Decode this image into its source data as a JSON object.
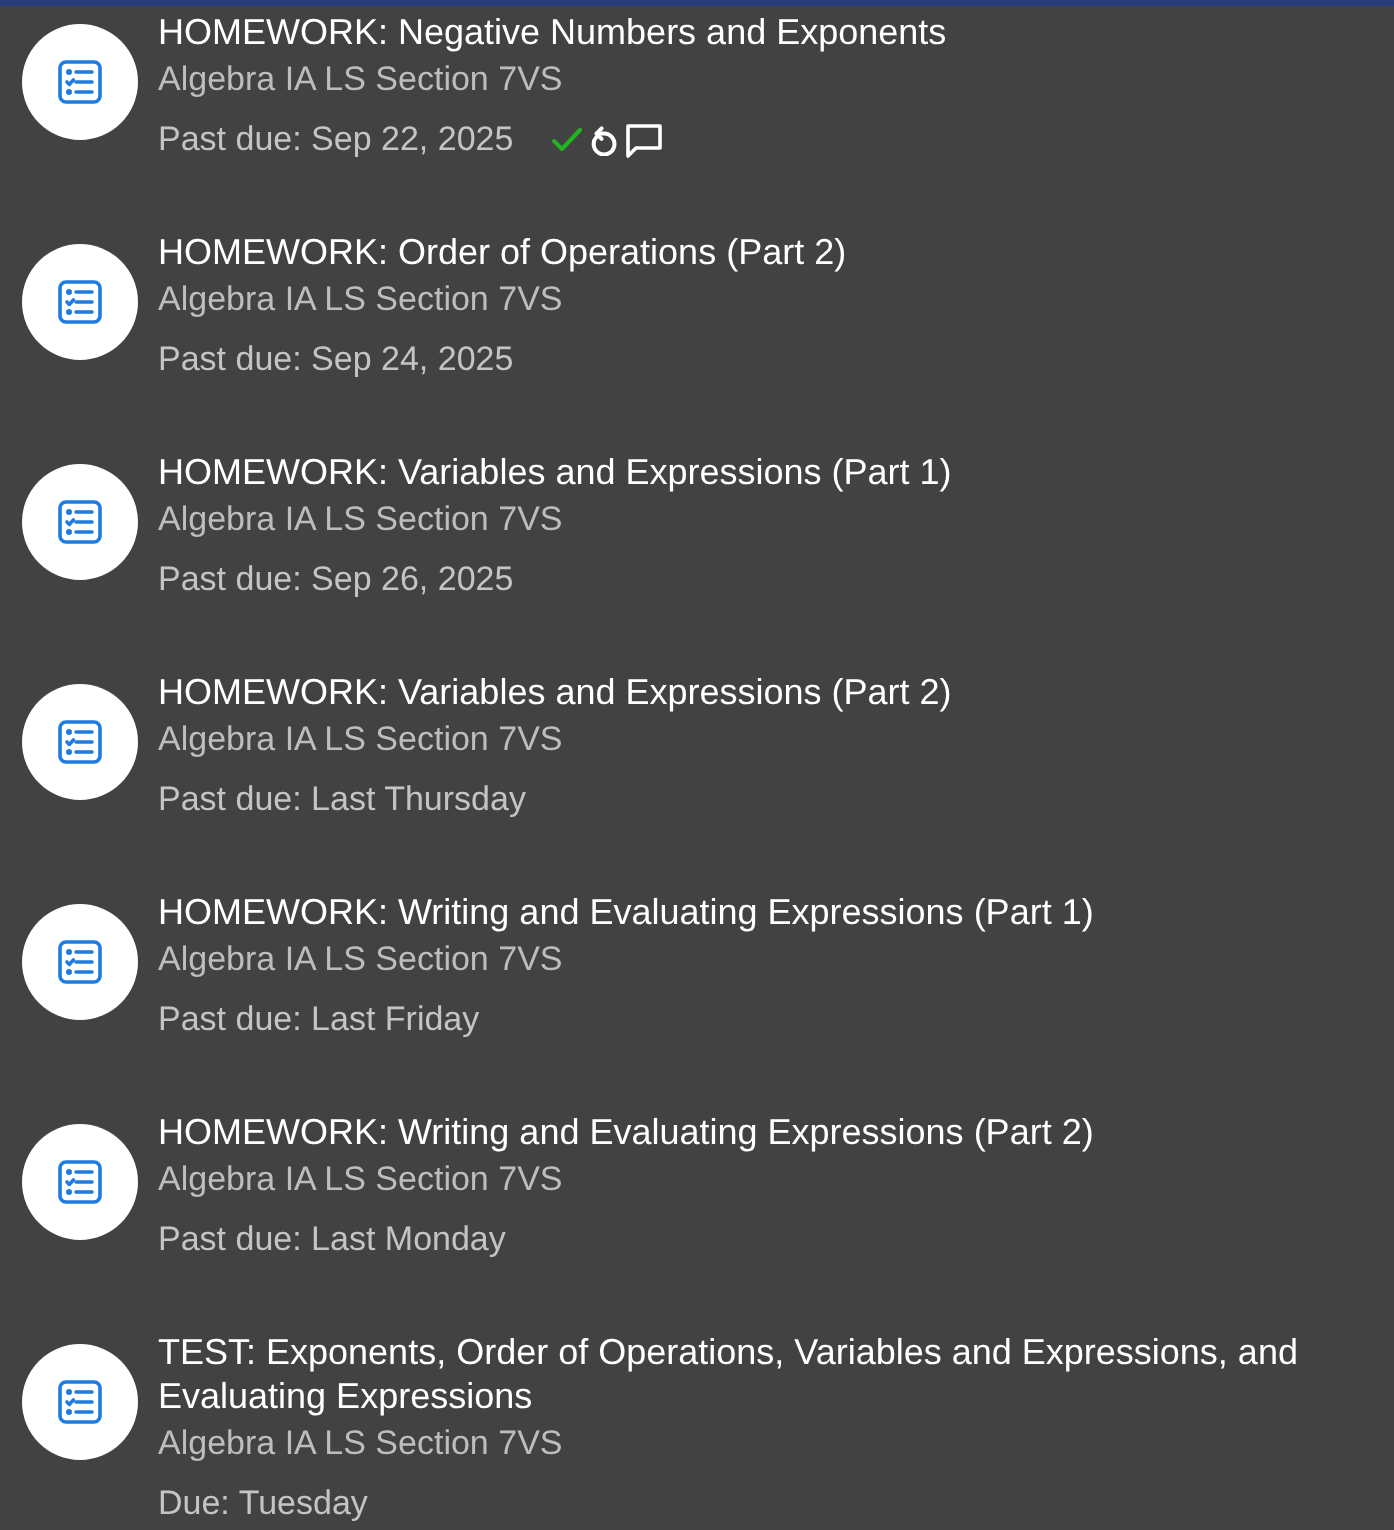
{
  "assignments": [
    {
      "title": "HOMEWORK: Negative Numbers and Exponents",
      "course": "Algebra IA LS Section 7VS",
      "due": "Past due: Sep 22, 2025",
      "indicators": [
        {
          "kind": "check"
        },
        {
          "kind": "redo"
        },
        {
          "kind": "comment"
        }
      ]
    },
    {
      "title": "HOMEWORK: Order of Operations (Part 2)",
      "course": "Algebra IA LS Section 7VS",
      "due": "Past due: Sep 24, 2025"
    },
    {
      "title": "HOMEWORK: Variables and Expressions (Part 1)",
      "course": "Algebra IA LS Section 7VS",
      "due": "Past due: Sep 26, 2025"
    },
    {
      "title": "HOMEWORK: Variables and Expressions (Part 2)",
      "course": "Algebra IA LS Section 7VS",
      "due": "Past due: Last Thursday"
    },
    {
      "title": "HOMEWORK: Writing and Evaluating Expressions (Part 1)",
      "course": "Algebra IA LS Section 7VS",
      "due": "Past due: Last Friday"
    },
    {
      "title": "HOMEWORK: Writing and Evaluating Expressions (Part 2)",
      "course": "Algebra IA LS Section 7VS",
      "due": "Past due: Last Monday"
    },
    {
      "title": "TEST: Exponents, Order of Operations, Variables and Expressions, and Evaluating Expressions",
      "course": "Algebra IA LS Section 7VS",
      "due": "Due: Tuesday"
    }
  ]
}
